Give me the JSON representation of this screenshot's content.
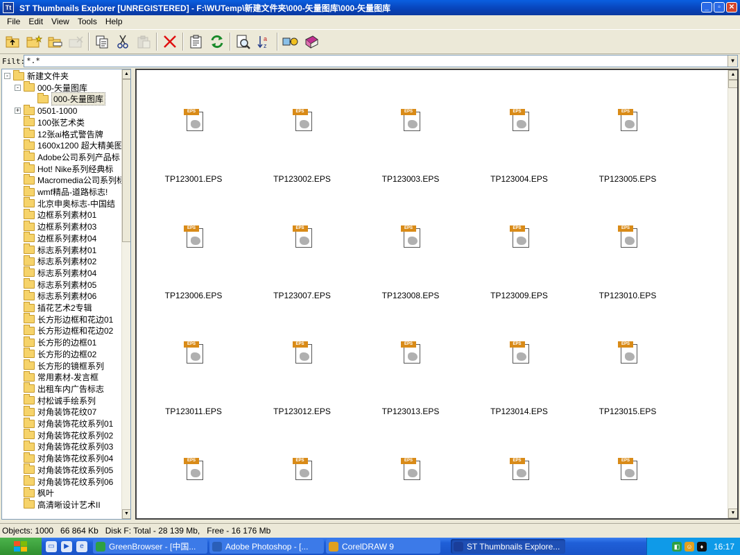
{
  "window": {
    "title": "ST Thumbnails Explorer [UNREGISTERED] - F:\\WUTemp\\新建文件夹\\000-矢量图库\\000-矢量图库",
    "buttons": [
      "_",
      "▫",
      "✕"
    ]
  },
  "menu": [
    {
      "label": "File"
    },
    {
      "label": "Edit"
    },
    {
      "label": "View"
    },
    {
      "label": "Tools"
    },
    {
      "label": "Help"
    }
  ],
  "toolbar": {
    "icons": [
      "folder-up-icon",
      "new-folder-icon",
      "rename-folder-icon",
      "delete-disabled-icon",
      "copy-icon",
      "cut-icon",
      "paste-icon",
      "delete-icon",
      "properties-icon",
      "refresh-icon",
      "preview-icon",
      "sort-icon",
      "plugins-icon",
      "help-book-icon"
    ]
  },
  "filter": {
    "label": "Filt:",
    "value": "*.*"
  },
  "tree": {
    "items": [
      {
        "label": "新建文件夹",
        "level": 0,
        "expander": "-"
      },
      {
        "label": "000-矢量图库",
        "level": 1,
        "expander": "-"
      },
      {
        "label": "000-矢量图库",
        "level": 2,
        "expander": "",
        "selected": true
      },
      {
        "label": "0501-1000",
        "level": 1,
        "expander": "+"
      },
      {
        "label": "100张艺术类",
        "level": 1,
        "expander": ""
      },
      {
        "label": "12张ai格式警告牌",
        "level": 1,
        "expander": ""
      },
      {
        "label": "1600x1200 超大精美图",
        "level": 1,
        "expander": ""
      },
      {
        "label": "Adobe公司系列产品标",
        "level": 1,
        "expander": ""
      },
      {
        "label": "Hot! Nike系列经典标",
        "level": 1,
        "expander": ""
      },
      {
        "label": "Macromedia公司系列标",
        "level": 1,
        "expander": ""
      },
      {
        "label": "wmf精品-道路标志!",
        "level": 1,
        "expander": ""
      },
      {
        "label": "北京申奥标志-中国结",
        "level": 1,
        "expander": ""
      },
      {
        "label": "边框系列素材01",
        "level": 1,
        "expander": ""
      },
      {
        "label": "边框系列素材03",
        "level": 1,
        "expander": ""
      },
      {
        "label": "边框系列素材04",
        "level": 1,
        "expander": ""
      },
      {
        "label": "标志系列素材01",
        "level": 1,
        "expander": ""
      },
      {
        "label": "标志系列素材02",
        "level": 1,
        "expander": ""
      },
      {
        "label": "标志系列素材04",
        "level": 1,
        "expander": ""
      },
      {
        "label": "标志系列素材05",
        "level": 1,
        "expander": ""
      },
      {
        "label": "标志系列素材06",
        "level": 1,
        "expander": ""
      },
      {
        "label": "插花艺术2专辑",
        "level": 1,
        "expander": ""
      },
      {
        "label": "长方形边框和花边01",
        "level": 1,
        "expander": ""
      },
      {
        "label": "长方形边框和花边02",
        "level": 1,
        "expander": ""
      },
      {
        "label": "长方形的边框01",
        "level": 1,
        "expander": ""
      },
      {
        "label": "长方形的边框02",
        "level": 1,
        "expander": ""
      },
      {
        "label": "长方形的镜框系列",
        "level": 1,
        "expander": ""
      },
      {
        "label": "常用素材-发言框",
        "level": 1,
        "expander": ""
      },
      {
        "label": "出租车内广告标志",
        "level": 1,
        "expander": ""
      },
      {
        "label": "村松诚手绘系列",
        "level": 1,
        "expander": ""
      },
      {
        "label": "对角装饰花纹07",
        "level": 1,
        "expander": ""
      },
      {
        "label": "对角装饰花纹系列01",
        "level": 1,
        "expander": ""
      },
      {
        "label": "对角装饰花纹系列02",
        "level": 1,
        "expander": ""
      },
      {
        "label": "对角装饰花纹系列03",
        "level": 1,
        "expander": ""
      },
      {
        "label": "对角装饰花纹系列04",
        "level": 1,
        "expander": ""
      },
      {
        "label": "对角装饰花纹系列05",
        "level": 1,
        "expander": ""
      },
      {
        "label": "对角装饰花纹系列06",
        "level": 1,
        "expander": ""
      },
      {
        "label": "枫叶",
        "level": 1,
        "expander": ""
      },
      {
        "label": "高清晰设计艺术II",
        "level": 1,
        "expander": ""
      }
    ]
  },
  "thumbnails": {
    "file_badge": "EPS",
    "items": [
      {
        "name": "TP123001.EPS"
      },
      {
        "name": "TP123002.EPS"
      },
      {
        "name": "TP123003.EPS"
      },
      {
        "name": "TP123004.EPS"
      },
      {
        "name": "TP123005.EPS"
      },
      {
        "name": "TP123006.EPS"
      },
      {
        "name": "TP123007.EPS"
      },
      {
        "name": "TP123008.EPS"
      },
      {
        "name": "TP123009.EPS"
      },
      {
        "name": "TP123010.EPS"
      },
      {
        "name": "TP123011.EPS"
      },
      {
        "name": "TP123012.EPS"
      },
      {
        "name": "TP123013.EPS"
      },
      {
        "name": "TP123014.EPS"
      },
      {
        "name": "TP123015.EPS"
      },
      {
        "name": ""
      },
      {
        "name": ""
      },
      {
        "name": ""
      },
      {
        "name": ""
      },
      {
        "name": ""
      }
    ]
  },
  "status": {
    "objects": "Objects: 1000",
    "size": "66 864 Kb",
    "disk": "Disk F: Total - 28 139 Mb,",
    "free": "Free - 16 176 Mb"
  },
  "taskbar": {
    "tasks": [
      {
        "label": "GreenBrowser - [中国...",
        "icon_color": "#2ea043",
        "active": false
      },
      {
        "label": "Adobe Photoshop - [...",
        "icon_color": "#2a5fb8",
        "active": false
      },
      {
        "label": "CorelDRAW 9",
        "icon_color": "#e0a020",
        "active": false
      },
      {
        "label": "ST Thumbnails Explore...",
        "icon_color": "#1a3e9a",
        "active": true
      }
    ],
    "clock": "16:17"
  }
}
